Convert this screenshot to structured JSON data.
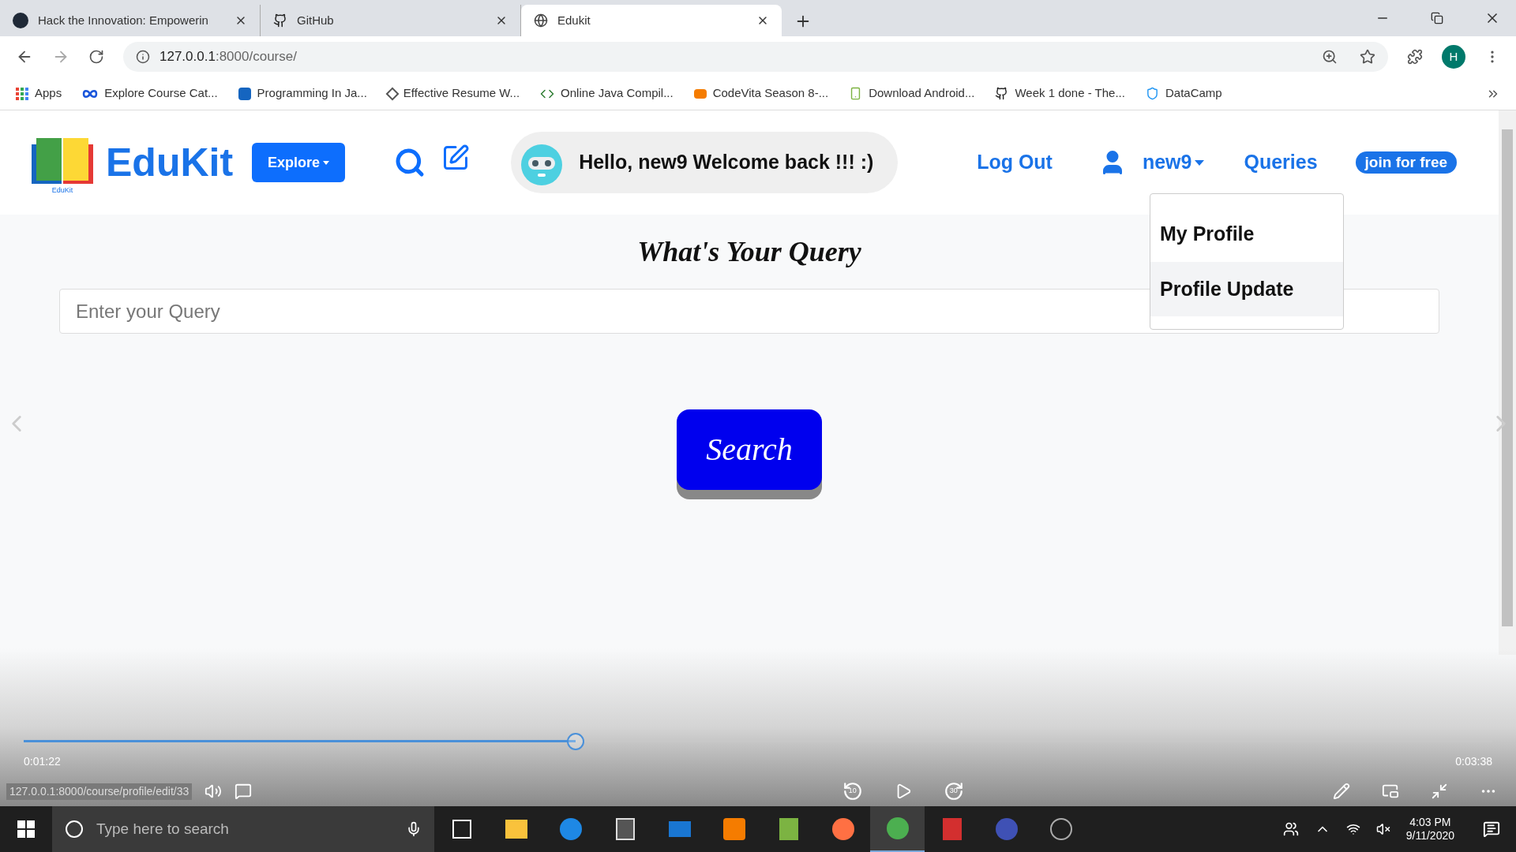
{
  "browser": {
    "tabs": [
      {
        "title": "Hack the Innovation: Empowerin",
        "kind": "devpost",
        "selected": false
      },
      {
        "title": "GitHub",
        "kind": "github",
        "selected": false
      },
      {
        "title": "Edukit",
        "kind": "globe",
        "selected": true
      }
    ],
    "url_host": "127.0.0.1",
    "url_path": ":8000/course/",
    "profile_initial": "H",
    "bookmarks": [
      {
        "label": "Apps",
        "kind": "apps"
      },
      {
        "label": "Explore Course Cat...",
        "kind": "infinity"
      },
      {
        "label": "Programming In Ja...",
        "kind": "s"
      },
      {
        "label": "Effective Resume W...",
        "kind": "diamond"
      },
      {
        "label": "Online Java Compil...",
        "kind": "code"
      },
      {
        "label": "CodeVita Season 8-...",
        "kind": "orange"
      },
      {
        "label": "Download Android...",
        "kind": "android"
      },
      {
        "label": "Week 1 done - The...",
        "kind": "github"
      },
      {
        "label": "DataCamp",
        "kind": "shield"
      }
    ]
  },
  "page": {
    "logo": "EduKit",
    "logo_caption": "EduKit",
    "explore": "Explore",
    "greeting": "Hello, new9 Welcome back !!! :)",
    "nav": {
      "logout": "Log Out",
      "user": "new9",
      "queries": "Queries",
      "join": "join for free"
    },
    "dropdown": [
      {
        "label": "My Profile",
        "selected": false
      },
      {
        "label": "Profile Update",
        "selected": true
      }
    ],
    "title": "What's Your Query",
    "query": {
      "placeholder": "Enter your Query"
    },
    "search": "Search"
  },
  "video": {
    "elapsed": "0:01:22",
    "total": "0:03:38",
    "level": 0.376,
    "skip_back": "10",
    "skip_forward": "30",
    "status_url": "127.0.0.1:8000/course/profile/edit/33"
  },
  "taskbar": {
    "search": {
      "placeholder": "Type here to search"
    },
    "time": "4:03 PM",
    "date": "9/11/2020"
  }
}
